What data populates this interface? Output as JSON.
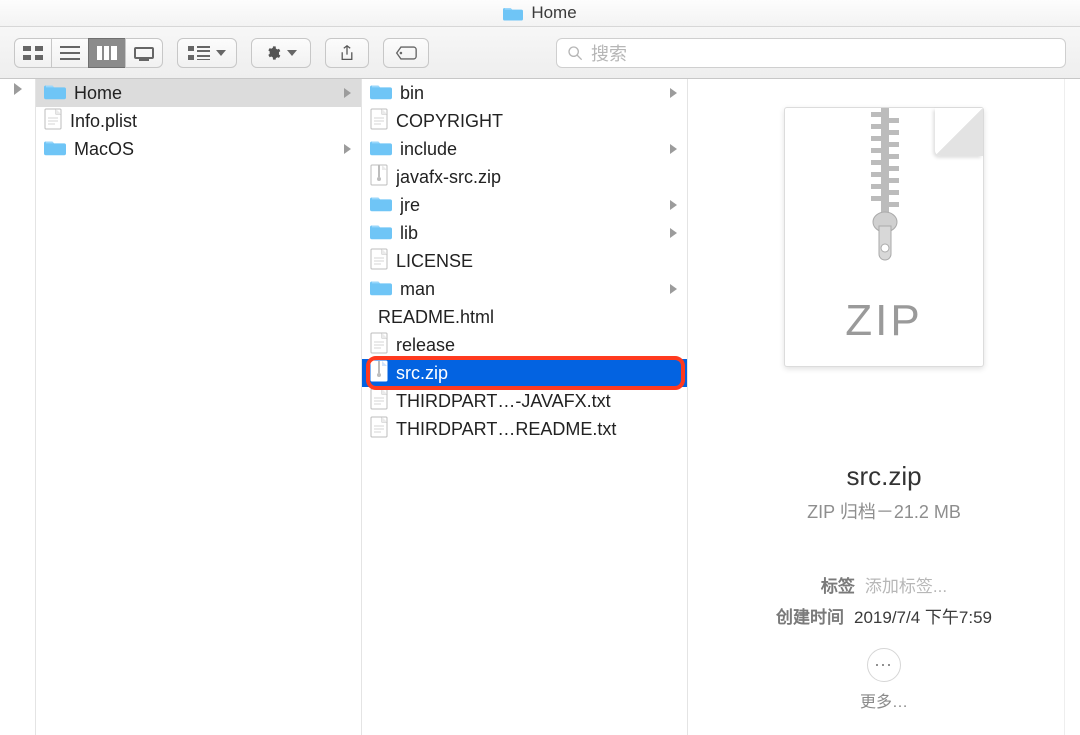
{
  "window": {
    "title": "Home"
  },
  "toolbar": {
    "search_placeholder": "搜索"
  },
  "column1": {
    "items": [
      {
        "name": "Home",
        "type": "folder",
        "hasChildren": true,
        "selected": true
      },
      {
        "name": "Info.plist",
        "type": "file",
        "hasChildren": false,
        "selected": false
      },
      {
        "name": "MacOS",
        "type": "folder",
        "hasChildren": true,
        "selected": false
      }
    ]
  },
  "column2": {
    "items": [
      {
        "name": "bin",
        "type": "folder",
        "hasChildren": true
      },
      {
        "name": "COPYRIGHT",
        "type": "file"
      },
      {
        "name": "include",
        "type": "folder",
        "hasChildren": true
      },
      {
        "name": "javafx-src.zip",
        "type": "zip"
      },
      {
        "name": "jre",
        "type": "folder",
        "hasChildren": true
      },
      {
        "name": "lib",
        "type": "folder",
        "hasChildren": true
      },
      {
        "name": "LICENSE",
        "type": "file"
      },
      {
        "name": "man",
        "type": "folder",
        "hasChildren": true
      },
      {
        "name": "README.html",
        "type": "html"
      },
      {
        "name": "release",
        "type": "file"
      },
      {
        "name": "src.zip",
        "type": "zip",
        "selected": true,
        "highlighted": true
      },
      {
        "name": "THIRDPART…-JAVAFX.txt",
        "type": "file"
      },
      {
        "name": "THIRDPART…README.txt",
        "type": "file"
      }
    ]
  },
  "preview": {
    "thumb_label": "ZIP",
    "filename": "src.zip",
    "kind_size": "ZIP 归档－21.2 MB",
    "tags_label": "标签",
    "tags_value": "添加标签...",
    "created_label": "创建时间",
    "created_value": "2019/7/4 下午7:59",
    "more_label": "更多…"
  }
}
